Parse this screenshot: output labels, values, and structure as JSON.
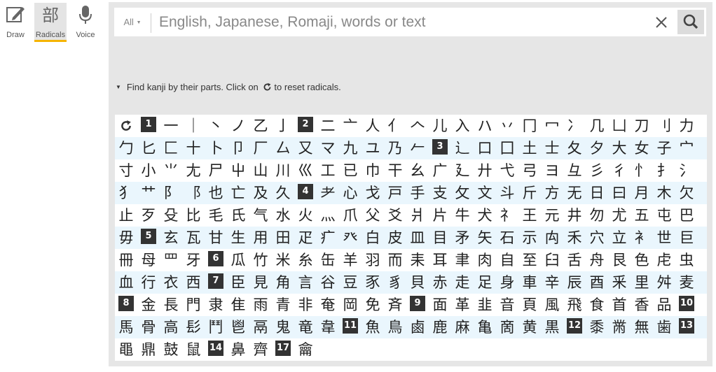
{
  "modes": [
    {
      "label": "Draw",
      "icon": "draw-icon",
      "active": false
    },
    {
      "label": "Radicals",
      "icon": "radicals-icon",
      "active": true,
      "glyph": "部"
    },
    {
      "label": "Voice",
      "icon": "microphone-icon",
      "active": false
    }
  ],
  "search": {
    "filter_label": "All",
    "placeholder": "English, Japanese, Romaji, words or text",
    "value": ""
  },
  "hint": {
    "before": "Find kanji by their parts. Click on",
    "after": "to reset radicals."
  },
  "colors": {
    "accent": "#f5b400",
    "panel": "#e6e6e6",
    "row_alt": "#eaf6fd",
    "stroke_badge": "#333333"
  },
  "radical_rows": [
    [
      "⟳",
      "1",
      "一",
      "｜",
      "丶",
      "ノ",
      "乙",
      "亅",
      "2",
      "二",
      "亠",
      "人",
      "亻",
      "𠆢",
      "儿",
      "入",
      "ハ",
      "丷",
      "冂",
      "冖",
      "冫",
      "几",
      "凵",
      "刀",
      "刂",
      "力"
    ],
    [
      "勹",
      "匕",
      "匚",
      "十",
      "卜",
      "卩",
      "厂",
      "厶",
      "又",
      "マ",
      "九",
      "ユ",
      "乃",
      "𠂉",
      "3",
      "⻌",
      "口",
      "囗",
      "土",
      "士",
      "夂",
      "夕",
      "大",
      "女",
      "子",
      "宀"
    ],
    [
      "寸",
      "小",
      "⺌",
      "尢",
      "尸",
      "屮",
      "山",
      "川",
      "巛",
      "工",
      "已",
      "巾",
      "干",
      "幺",
      "广",
      "廴",
      "廾",
      "弋",
      "弓",
      "ヨ",
      "彑",
      "彡",
      "彳",
      "忄",
      "扌",
      "氵"
    ],
    [
      "犭",
      "艹",
      "阝",
      "⻏",
      "也",
      "亡",
      "及",
      "久",
      "4",
      "耂",
      "心",
      "戈",
      "戸",
      "手",
      "支",
      "攵",
      "文",
      "斗",
      "斤",
      "方",
      "无",
      "日",
      "曰",
      "月",
      "木",
      "欠"
    ],
    [
      "止",
      "歹",
      "殳",
      "比",
      "毛",
      "氏",
      "气",
      "水",
      "火",
      "灬",
      "爪",
      "父",
      "爻",
      "爿",
      "片",
      "牛",
      "犬",
      "礻",
      "王",
      "元",
      "井",
      "勿",
      "尤",
      "五",
      "屯",
      "巴"
    ],
    [
      "毋",
      "5",
      "玄",
      "瓦",
      "甘",
      "生",
      "用",
      "田",
      "疋",
      "疒",
      "癶",
      "白",
      "皮",
      "皿",
      "目",
      "矛",
      "矢",
      "石",
      "示",
      "禸",
      "禾",
      "穴",
      "立",
      "衤",
      "世",
      "巨"
    ],
    [
      "冊",
      "母",
      "罒",
      "牙",
      "6",
      "瓜",
      "竹",
      "米",
      "糸",
      "缶",
      "羊",
      "羽",
      "而",
      "耒",
      "耳",
      "聿",
      "肉",
      "自",
      "至",
      "臼",
      "舌",
      "舟",
      "艮",
      "色",
      "虍",
      "虫"
    ],
    [
      "血",
      "行",
      "衣",
      "西",
      "7",
      "臣",
      "見",
      "角",
      "言",
      "谷",
      "豆",
      "豕",
      "豸",
      "貝",
      "赤",
      "走",
      "足",
      "身",
      "車",
      "辛",
      "辰",
      "酉",
      "釆",
      "里",
      "舛",
      "麦"
    ],
    [
      "8",
      "金",
      "長",
      "門",
      "隶",
      "隹",
      "雨",
      "青",
      "非",
      "奄",
      "岡",
      "免",
      "斉",
      "9",
      "面",
      "革",
      "韭",
      "音",
      "頁",
      "風",
      "飛",
      "食",
      "首",
      "香",
      "品",
      "10"
    ],
    [
      "馬",
      "骨",
      "高",
      "髟",
      "鬥",
      "鬯",
      "鬲",
      "鬼",
      "竜",
      "韋",
      "11",
      "魚",
      "鳥",
      "鹵",
      "鹿",
      "麻",
      "亀",
      "啇",
      "黄",
      "黒",
      "12",
      "黍",
      "黹",
      "無",
      "歯",
      "13"
    ],
    [
      "黽",
      "鼎",
      "鼓",
      "鼠",
      "14",
      "鼻",
      "齊",
      "17",
      "龠"
    ]
  ]
}
